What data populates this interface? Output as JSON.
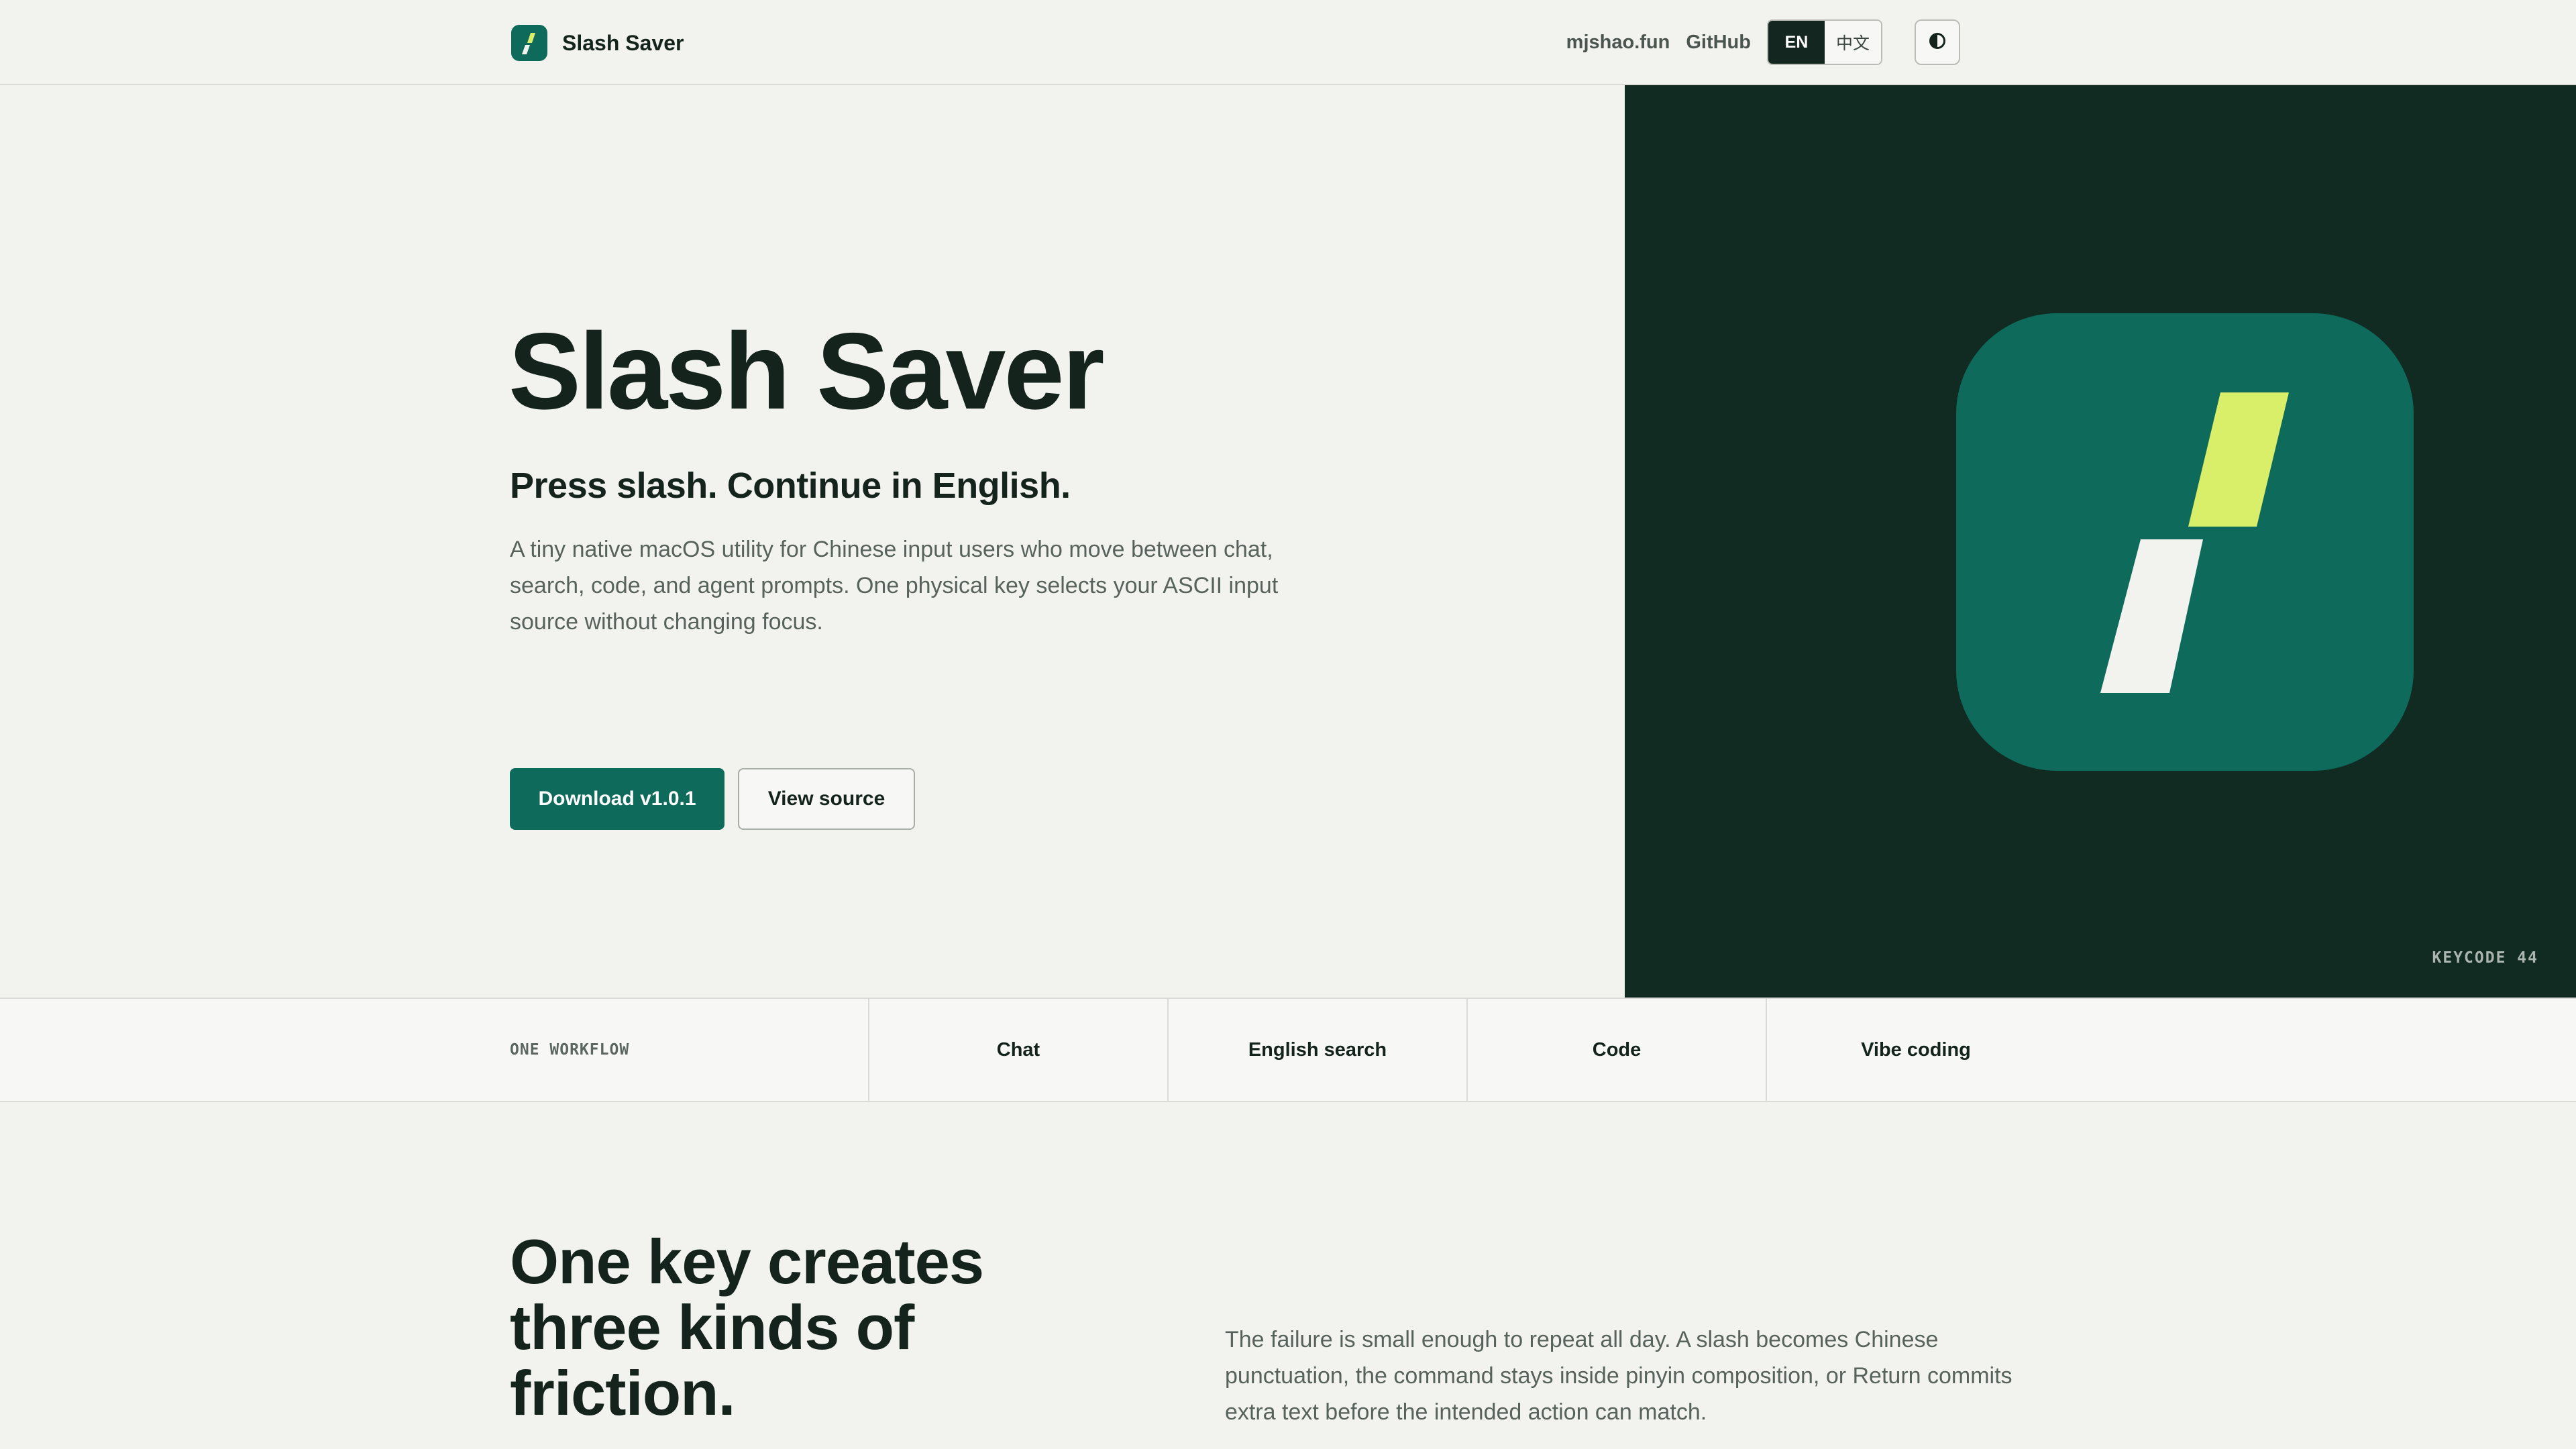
{
  "header": {
    "brand_name": "Slash Saver",
    "nav_links": [
      "mjshao.fun",
      "GitHub"
    ],
    "lang_options": [
      "EN",
      "中文"
    ],
    "lang_selected": "EN",
    "theme_toggle_icon": "contrast-icon"
  },
  "hero": {
    "title": "Slash Saver",
    "subtitle": "Press slash. Continue in English.",
    "description": "A tiny native macOS utility for Chinese input users who move between chat, search, code, and agent prompts. One physical key selects your ASCII input source without changing focus.",
    "primary_button": "Download v1.0.1",
    "secondary_button": "View source",
    "keycode_label": "KEYCODE 44",
    "icon": "slash-logo-icon"
  },
  "workflow": {
    "label": "ONE WORKFLOW",
    "items": [
      "Chat",
      "English search",
      "Code",
      "Vibe coding"
    ]
  },
  "friction": {
    "title": "One key creates three kinds of friction.",
    "description": "The failure is small enough to repeat all day. A slash becomes Chinese punctuation, the command stays inside pinyin composition, or Return commits extra text before the intended action can match."
  },
  "colors": {
    "background": "#f2f3ef",
    "brand_green": "#0e6b5c",
    "dark_panel": "#112a22",
    "accent_lime": "#d9ef6a",
    "text_dark": "#14241d"
  }
}
